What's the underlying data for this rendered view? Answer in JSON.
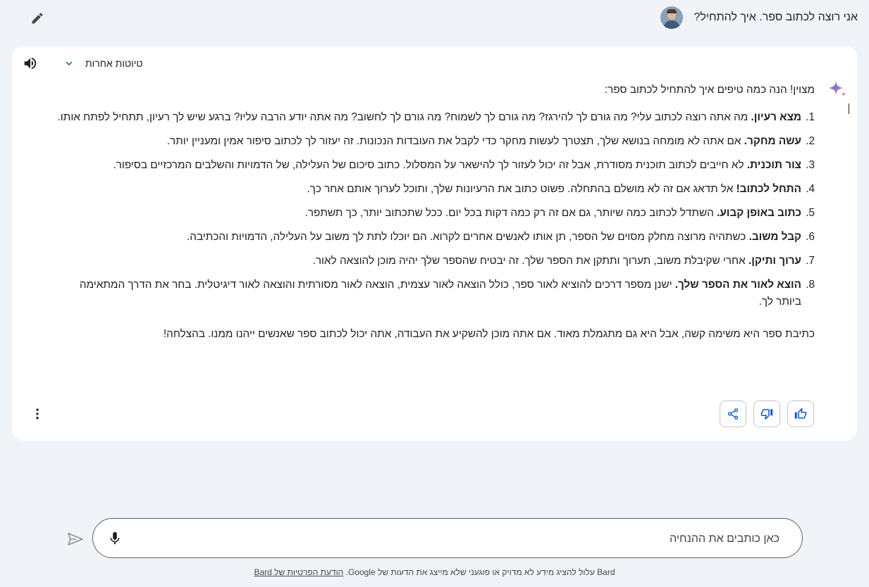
{
  "conversation": {
    "user_prompt": "אני רוצה לכתוב ספר. איך להתחיל?"
  },
  "response": {
    "drafts_label": "טיוטות אחרות",
    "intro": "מצוין! הנה כמה טיפים איך להתחיל לכתוב ספר:",
    "steps": [
      {
        "num": "1.",
        "title": "מצא רעיון.",
        "text": " מה אתה רוצה לכתוב עלי? מה גורם לך להירגז? מה גורם לך לשמוח? מה גורם לך לחשוב? מה אתה יודע הרבה עליו? ברגע שיש לך רעיון, תתחיל לפתח אותו."
      },
      {
        "num": "2.",
        "title": "עשה מחקר.",
        "text": " אם אתה לא מומחה בנושא שלך, תצטרך לעשות מחקר כדי לקבל את העובדות הנכונות. זה יעזור לך לכתוב סיפור אמין ומעניין יותר."
      },
      {
        "num": "3.",
        "title": "צור תוכנית.",
        "text": " לא חייבים לכתוב תוכנית מסודרת, אבל זה יכול לעזור לך להישאר על המסלול. כתוב סיכום של העלילה, של הדמויות והשלבים המרכזיים בסיפור."
      },
      {
        "num": "4.",
        "title": "התחל לכתוב!",
        "text": " אל תדאג אם זה לא מושלם בהתחלה. פשוט כתוב את הרעיונות שלך, ותוכל לערוך אותם אחר כך."
      },
      {
        "num": "5.",
        "title": "כתוב באופן קבוע.",
        "text": " השתדל לכתוב כמה שיותר, גם אם זה רק כמה דקות בכל יום. ככל שתכתוב יותר, כך תשתפר."
      },
      {
        "num": "6.",
        "title": "קבל משוב.",
        "text": " כשתהיה מרוצה מחלק מסוים של הספר, תן אותו לאנשים אחרים לקרוא. הם יוכלו לתת לך משוב על העלילה, הדמויות והכתיבה."
      },
      {
        "num": "7.",
        "title": "ערוך ותיקן.",
        "text": " אחרי שקיבלת משוב, תערוך ותתקן את הספר שלך. זה יבטיח שהספר שלך יהיה מוכן להוצאה לאור."
      },
      {
        "num": "8.",
        "title": "הוצא לאור את הספר שלך.",
        "text": " ישנן מספר דרכים להוציא לאור ספר, כולל הוצאה לאור עצמית, הוצאה לאור מסורתית והוצאה לאור דיגיטלית. בחר את הדרך המתאימה ביותר לך."
      }
    ],
    "closing": "כתיבת ספר היא משימה קשה, אבל היא גם מתגמלת מאוד. אם אתה מוכן להשקיע את העבודה, אתה יכול לכתוב ספר שאנשים ייהנו ממנו. בהצלחה!"
  },
  "input": {
    "placeholder": "כאן כותבים את ההנחיה"
  },
  "footer": {
    "disclaimer": "Bard עלול להציג מידע לא מדויק או פוגעני שלא מייצג את הדעות של Google. ",
    "privacy_link": "הודעת הפרטיות של Bard"
  },
  "icons": {
    "edit": "pencil-icon",
    "speaker": "volume-icon",
    "chevron": "chevron-down-icon",
    "sparkle": "bard-sparkle-icon",
    "more": "more-vert-icon",
    "share": "share-icon",
    "thumb_down": "thumb-down-icon",
    "thumb_up": "thumb-up-icon",
    "mic": "mic-icon",
    "send": "send-icon"
  },
  "colors": {
    "background": "#f0f4f9",
    "card": "#ffffff",
    "accent_blue": "#0b57d0",
    "sparkle_start": "#4285f4",
    "sparkle_end": "#d96570"
  }
}
